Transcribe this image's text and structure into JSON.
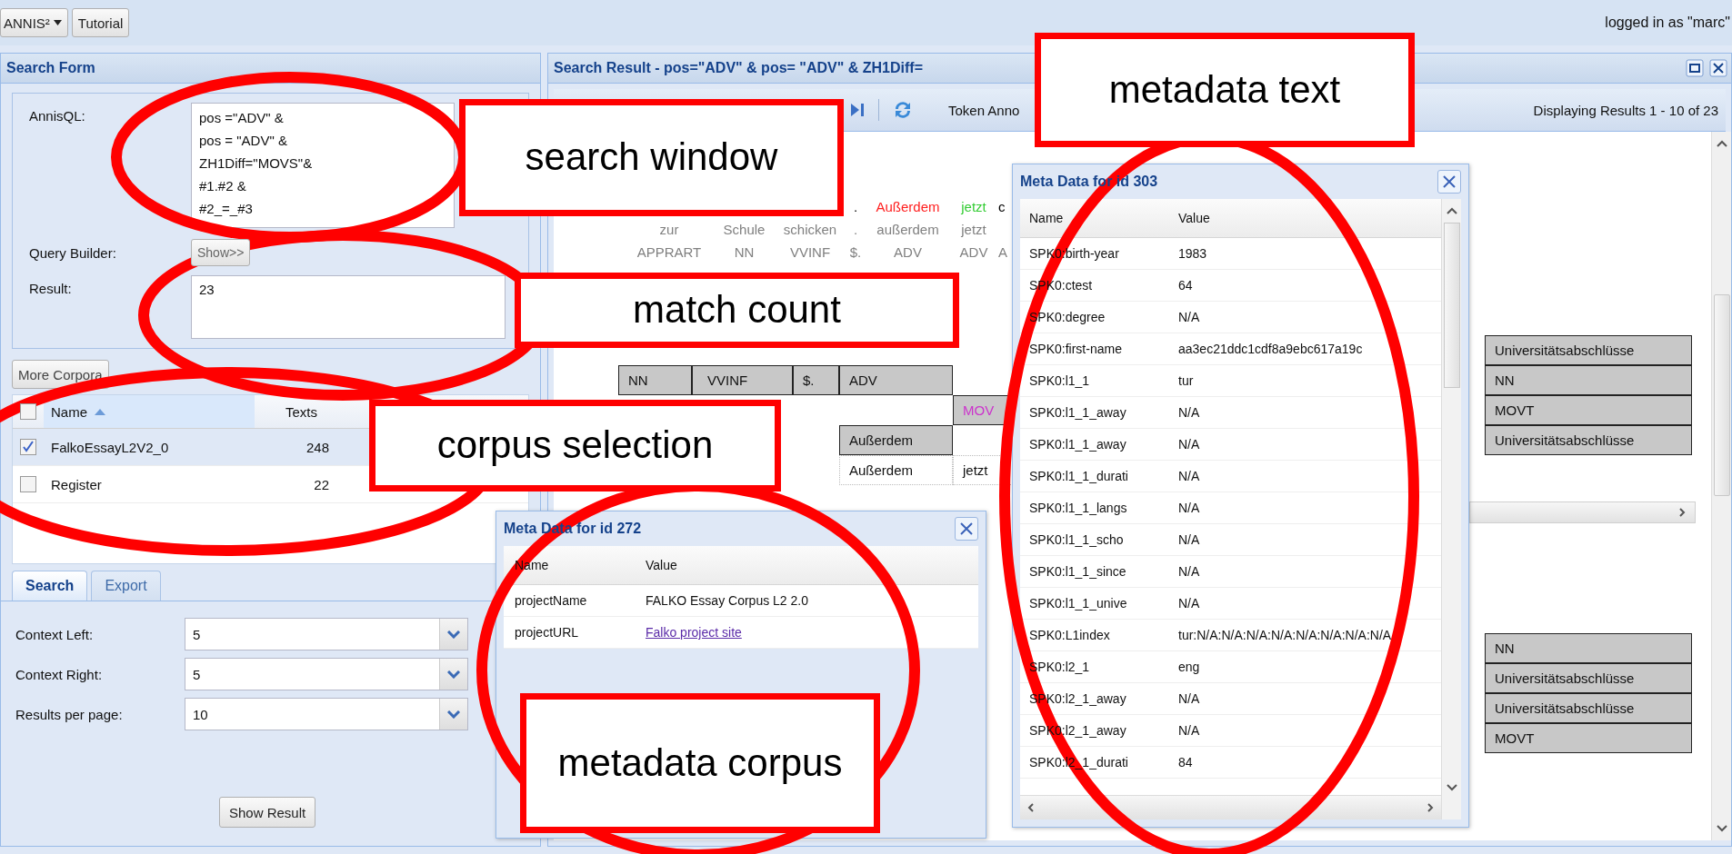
{
  "top_bar": {
    "app_menu": "ANNIS²",
    "tutorial": "Tutorial",
    "user": "logged in as \"marc\""
  },
  "search_form": {
    "title": "Search Form",
    "query_label": "AnnisQL:",
    "query_lines": [
      "pos =\"ADV\" &",
      "pos =  \"ADV\" &",
      "ZH1Diff=\"MOVS\"&",
      "#1.#2 &",
      "#2_=_#3"
    ],
    "builder_label": "Query Builder:",
    "builder_button": "Show>>",
    "result_label": "Result:",
    "result_value": "23",
    "more_corpora": "More Corpora",
    "corpus_table": {
      "columns": [
        "Name",
        "Texts"
      ],
      "sort_ascending": true,
      "all_checked": false,
      "rows": [
        {
          "name": "FalkoEssayL2V2_0",
          "texts": "248",
          "checked": true
        },
        {
          "name": "Register",
          "texts": "22",
          "checked": false
        }
      ]
    },
    "tabs": [
      {
        "label": "Search",
        "selected": true
      },
      {
        "label": "Export",
        "selected": false
      }
    ],
    "fields": [
      {
        "label": "Context Left:",
        "value": "5"
      },
      {
        "label": "Context Right:",
        "value": "5"
      },
      {
        "label": "Results per page:",
        "value": "10"
      }
    ],
    "show_button": "Show Result"
  },
  "search_result": {
    "title": "Search Result - pos=\"ADV\" & pos= \"ADV\" & ZH1Diff=",
    "toolbar_label": "Token Anno",
    "paging": "Displaying Results 1 - 10 of 23",
    "kwic_lines": [
      {
        "kind": "token",
        "tokens": [
          {
            "text": "."
          },
          {
            "text": "Außerdem",
            "color": "#ff2020"
          },
          {
            "text": "jetzt",
            "color": "#33cc33"
          },
          {
            "text": "c"
          }
        ]
      },
      {
        "kind": "lemma",
        "tokens": [
          {
            "text": "zur"
          },
          {
            "text": "Schule"
          },
          {
            "text": "schicken"
          },
          {
            "text": "."
          },
          {
            "text": "außerdem"
          },
          {
            "text": "jetzt"
          }
        ]
      },
      {
        "kind": "pos",
        "tokens": [
          {
            "text": "APPRART"
          },
          {
            "text": "NN"
          },
          {
            "text": "VVINF"
          },
          {
            "text": "$."
          },
          {
            "text": "ADV"
          },
          {
            "text": "ADV"
          },
          {
            "text": "A"
          }
        ]
      }
    ],
    "grid_upper": [
      {
        "kind": "annotation",
        "right": "Universitätsabschlüsse"
      },
      {
        "kind": "annotation",
        "column_1": "NN",
        "column_2": "VVINF",
        "column_3": "$.",
        "column_4": "ADV",
        "right": "NN"
      },
      {
        "kind": "annotation",
        "color": "#cc33cc",
        "column_5": "MOV",
        "right": "MOVT"
      },
      {
        "kind": "annotation",
        "column_4": "Außerdem",
        "right": "Universitätsabschlüsse"
      },
      {
        "kind": "token",
        "column_4": "Außerdem",
        "column_5": "jetzt"
      }
    ],
    "grid_lower": [
      "NN",
      "Universitätsabschlüsse",
      "Universitätsabschlüsse",
      "MOVT"
    ]
  },
  "metadata_corpus": {
    "title": "Meta Data for id 272",
    "columns": [
      "Name",
      "Value"
    ],
    "rows": [
      {
        "name": "projectName",
        "value": "FALKO Essay Corpus L2 2.0",
        "kind": "text"
      },
      {
        "name": "projectURL",
        "value": "Falko project site",
        "kind": "link"
      }
    ]
  },
  "metadata_text": {
    "title": "Meta Data for id 303",
    "columns": [
      "Name",
      "Value"
    ],
    "rows": [
      {
        "name": "SPK0:birth-year",
        "value": "1983"
      },
      {
        "name": "SPK0:ctest",
        "value": "64"
      },
      {
        "name": "SPK0:degree",
        "value": "N/A"
      },
      {
        "name": "SPK0:first-name",
        "value": "aa3ec21ddc1cdf8a9ebc617a19c"
      },
      {
        "name": "SPK0:l1_1",
        "value": "tur"
      },
      {
        "name": "SPK0:l1_1_away",
        "value": "N/A"
      },
      {
        "name": "SPK0:l1_1_away",
        "value": "N/A"
      },
      {
        "name": "SPK0:l1_1_durati",
        "value": "N/A"
      },
      {
        "name": "SPK0:l1_1_langs",
        "value": "N/A"
      },
      {
        "name": "SPK0:l1_1_scho",
        "value": "N/A"
      },
      {
        "name": "SPK0:l1_1_since",
        "value": "N/A"
      },
      {
        "name": "SPK0:l1_1_unive",
        "value": "N/A"
      },
      {
        "name": "SPK0:L1index",
        "value": "tur:N/A:N/A:N/A:N/A:N/A:N/A:N/A:N/A"
      },
      {
        "name": "SPK0:l2_1",
        "value": "eng"
      },
      {
        "name": "SPK0:l2_1_away",
        "value": "N/A"
      },
      {
        "name": "SPK0:l2_1_away",
        "value": "N/A"
      },
      {
        "name": "SPK0:l2_1_durati",
        "value": "84"
      }
    ]
  },
  "annotations": [
    {
      "label": "search window"
    },
    {
      "label": "match count"
    },
    {
      "label": "corpus selection"
    },
    {
      "label": "metadata text"
    },
    {
      "label": "metadata corpus"
    }
  ]
}
